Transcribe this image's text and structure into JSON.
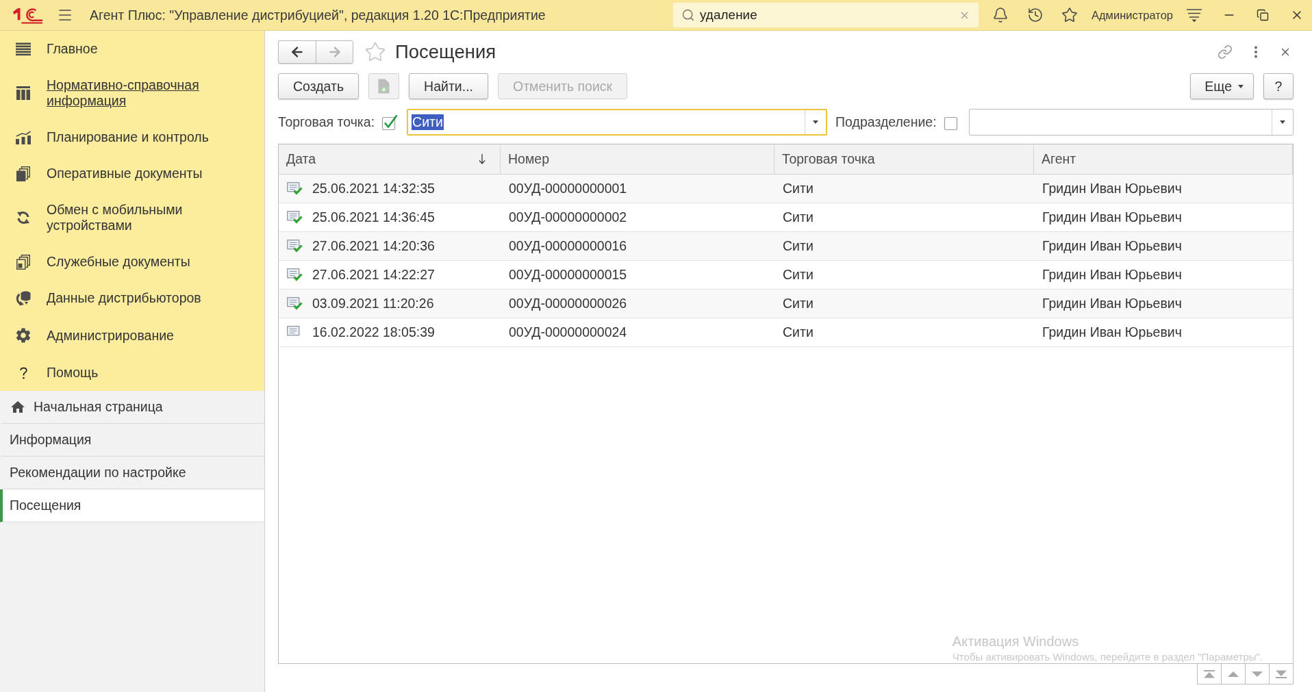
{
  "title_bar": {
    "title": "Агент Плюс: \"Управление дистрибуцией\", редакция 1.20 1С:Предприятие",
    "search": {
      "value": "удаление"
    },
    "user": "Администратор"
  },
  "sidebar": {
    "sections": [
      {
        "label": "Главное",
        "hovered": false
      },
      {
        "label": "Нормативно-справочная информация",
        "hovered": true
      },
      {
        "label": "Планирование и контроль",
        "hovered": false
      },
      {
        "label": "Оперативные документы",
        "hovered": false
      },
      {
        "label": "Обмен с мобильными устройствами",
        "hovered": false
      },
      {
        "label": "Служебные документы",
        "hovered": false
      },
      {
        "label": "Данные дистрибьюторов",
        "hovered": false
      },
      {
        "label": "Администрирование",
        "hovered": false
      },
      {
        "label": "Помощь",
        "hovered": false
      }
    ],
    "open_pages": [
      {
        "label": "Начальная страница",
        "selected": false
      },
      {
        "label": "Информация",
        "selected": false
      },
      {
        "label": "Рекомендации по настройке",
        "selected": false
      },
      {
        "label": "Посещения",
        "selected": true
      }
    ]
  },
  "form": {
    "title": "Посещения",
    "favorite": false,
    "back_enabled": true,
    "forward_enabled": false,
    "commands": [
      {
        "kind": "text",
        "label": "Создать",
        "disabled": false
      },
      {
        "kind": "icon",
        "disabled": true
      },
      {
        "kind": "text",
        "label": "Найти...",
        "disabled": false
      },
      {
        "kind": "text",
        "label": "Отменить поиск",
        "disabled": true
      }
    ],
    "more_button": {
      "label": "Еще"
    },
    "help_button": {
      "label": "?"
    },
    "filters": [
      {
        "label": "Торговая точка:",
        "checked": true,
        "value": "Сити",
        "focused": true
      },
      {
        "label": "Подразделение:",
        "checked": false,
        "focused": false
      }
    ],
    "table": {
      "columns": [
        {
          "label": "Дата",
          "sorted": true
        },
        {
          "label": "Номер",
          "sorted": false
        },
        {
          "label": "Торговая точка",
          "sorted": false
        },
        {
          "label": "Агент",
          "sorted": false
        }
      ],
      "rows": [
        {
          "posted": true,
          "date": "25.06.2021 14:32:35",
          "number": "00УД-00000000001",
          "outlet": "Сити",
          "agent": "Гридин Иван Юрьевич"
        },
        {
          "posted": true,
          "date": "25.06.2021 14:36:45",
          "number": "00УД-00000000002",
          "outlet": "Сити",
          "agent": "Гридин Иван Юрьевич"
        },
        {
          "posted": true,
          "date": "27.06.2021 14:20:36",
          "number": "00УД-00000000016",
          "outlet": "Сити",
          "agent": "Гридин Иван Юрьевич"
        },
        {
          "posted": true,
          "date": "27.06.2021 14:22:27",
          "number": "00УД-00000000015",
          "outlet": "Сити",
          "agent": "Гридин Иван Юрьевич"
        },
        {
          "posted": true,
          "date": "03.09.2021 11:20:26",
          "number": "00УД-00000000026",
          "outlet": "Сити",
          "agent": "Гридин Иван Юрьевич"
        },
        {
          "posted": false,
          "date": "16.02.2022 18:05:39",
          "number": "00УД-00000000024",
          "outlet": "Сити",
          "agent": "Гридин Иван Юрьевич"
        }
      ]
    }
  },
  "windows_notice": {
    "title": "Активация Windows",
    "text": "Чтобы активировать Windows, перейдите в раздел \"Параметры\"."
  }
}
